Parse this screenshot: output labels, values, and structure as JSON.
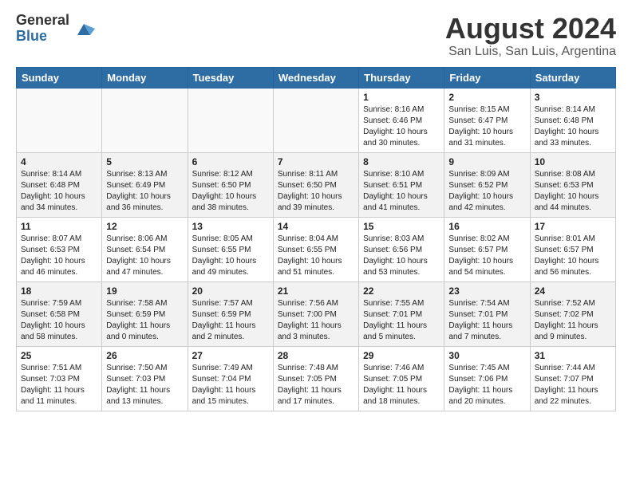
{
  "header": {
    "logo_general": "General",
    "logo_blue": "Blue",
    "title": "August 2024",
    "location": "San Luis, San Luis, Argentina"
  },
  "days_of_week": [
    "Sunday",
    "Monday",
    "Tuesday",
    "Wednesday",
    "Thursday",
    "Friday",
    "Saturday"
  ],
  "weeks": [
    {
      "stripe": "odd",
      "days": [
        {
          "num": "",
          "info": ""
        },
        {
          "num": "",
          "info": ""
        },
        {
          "num": "",
          "info": ""
        },
        {
          "num": "",
          "info": ""
        },
        {
          "num": "1",
          "info": "Sunrise: 8:16 AM\nSunset: 6:46 PM\nDaylight: 10 hours and 30 minutes."
        },
        {
          "num": "2",
          "info": "Sunrise: 8:15 AM\nSunset: 6:47 PM\nDaylight: 10 hours and 31 minutes."
        },
        {
          "num": "3",
          "info": "Sunrise: 8:14 AM\nSunset: 6:48 PM\nDaylight: 10 hours and 33 minutes."
        }
      ]
    },
    {
      "stripe": "even",
      "days": [
        {
          "num": "4",
          "info": "Sunrise: 8:14 AM\nSunset: 6:48 PM\nDaylight: 10 hours and 34 minutes."
        },
        {
          "num": "5",
          "info": "Sunrise: 8:13 AM\nSunset: 6:49 PM\nDaylight: 10 hours and 36 minutes."
        },
        {
          "num": "6",
          "info": "Sunrise: 8:12 AM\nSunset: 6:50 PM\nDaylight: 10 hours and 38 minutes."
        },
        {
          "num": "7",
          "info": "Sunrise: 8:11 AM\nSunset: 6:50 PM\nDaylight: 10 hours and 39 minutes."
        },
        {
          "num": "8",
          "info": "Sunrise: 8:10 AM\nSunset: 6:51 PM\nDaylight: 10 hours and 41 minutes."
        },
        {
          "num": "9",
          "info": "Sunrise: 8:09 AM\nSunset: 6:52 PM\nDaylight: 10 hours and 42 minutes."
        },
        {
          "num": "10",
          "info": "Sunrise: 8:08 AM\nSunset: 6:53 PM\nDaylight: 10 hours and 44 minutes."
        }
      ]
    },
    {
      "stripe": "odd",
      "days": [
        {
          "num": "11",
          "info": "Sunrise: 8:07 AM\nSunset: 6:53 PM\nDaylight: 10 hours and 46 minutes."
        },
        {
          "num": "12",
          "info": "Sunrise: 8:06 AM\nSunset: 6:54 PM\nDaylight: 10 hours and 47 minutes."
        },
        {
          "num": "13",
          "info": "Sunrise: 8:05 AM\nSunset: 6:55 PM\nDaylight: 10 hours and 49 minutes."
        },
        {
          "num": "14",
          "info": "Sunrise: 8:04 AM\nSunset: 6:55 PM\nDaylight: 10 hours and 51 minutes."
        },
        {
          "num": "15",
          "info": "Sunrise: 8:03 AM\nSunset: 6:56 PM\nDaylight: 10 hours and 53 minutes."
        },
        {
          "num": "16",
          "info": "Sunrise: 8:02 AM\nSunset: 6:57 PM\nDaylight: 10 hours and 54 minutes."
        },
        {
          "num": "17",
          "info": "Sunrise: 8:01 AM\nSunset: 6:57 PM\nDaylight: 10 hours and 56 minutes."
        }
      ]
    },
    {
      "stripe": "even",
      "days": [
        {
          "num": "18",
          "info": "Sunrise: 7:59 AM\nSunset: 6:58 PM\nDaylight: 10 hours and 58 minutes."
        },
        {
          "num": "19",
          "info": "Sunrise: 7:58 AM\nSunset: 6:59 PM\nDaylight: 11 hours and 0 minutes."
        },
        {
          "num": "20",
          "info": "Sunrise: 7:57 AM\nSunset: 6:59 PM\nDaylight: 11 hours and 2 minutes."
        },
        {
          "num": "21",
          "info": "Sunrise: 7:56 AM\nSunset: 7:00 PM\nDaylight: 11 hours and 3 minutes."
        },
        {
          "num": "22",
          "info": "Sunrise: 7:55 AM\nSunset: 7:01 PM\nDaylight: 11 hours and 5 minutes."
        },
        {
          "num": "23",
          "info": "Sunrise: 7:54 AM\nSunset: 7:01 PM\nDaylight: 11 hours and 7 minutes."
        },
        {
          "num": "24",
          "info": "Sunrise: 7:52 AM\nSunset: 7:02 PM\nDaylight: 11 hours and 9 minutes."
        }
      ]
    },
    {
      "stripe": "odd",
      "days": [
        {
          "num": "25",
          "info": "Sunrise: 7:51 AM\nSunset: 7:03 PM\nDaylight: 11 hours and 11 minutes."
        },
        {
          "num": "26",
          "info": "Sunrise: 7:50 AM\nSunset: 7:03 PM\nDaylight: 11 hours and 13 minutes."
        },
        {
          "num": "27",
          "info": "Sunrise: 7:49 AM\nSunset: 7:04 PM\nDaylight: 11 hours and 15 minutes."
        },
        {
          "num": "28",
          "info": "Sunrise: 7:48 AM\nSunset: 7:05 PM\nDaylight: 11 hours and 17 minutes."
        },
        {
          "num": "29",
          "info": "Sunrise: 7:46 AM\nSunset: 7:05 PM\nDaylight: 11 hours and 18 minutes."
        },
        {
          "num": "30",
          "info": "Sunrise: 7:45 AM\nSunset: 7:06 PM\nDaylight: 11 hours and 20 minutes."
        },
        {
          "num": "31",
          "info": "Sunrise: 7:44 AM\nSunset: 7:07 PM\nDaylight: 11 hours and 22 minutes."
        }
      ]
    }
  ]
}
